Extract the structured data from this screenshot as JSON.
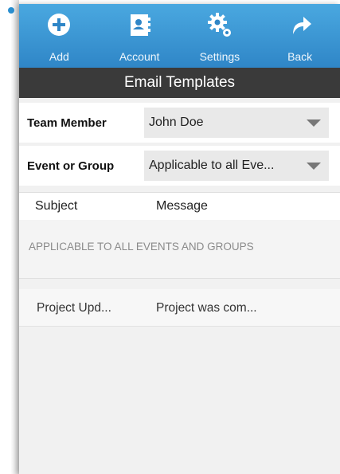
{
  "toolbar": {
    "add": {
      "label": "Add",
      "icon": "plus-circle-icon"
    },
    "account": {
      "label": "Account",
      "icon": "address-book-icon"
    },
    "settings": {
      "label": "Settings",
      "icon": "gear-icon"
    },
    "back": {
      "label": "Back",
      "icon": "back-arrow-icon"
    }
  },
  "title": "Email Templates",
  "form": {
    "team_member": {
      "label": "Team Member",
      "value": "John Doe"
    },
    "event_group": {
      "label": "Event or Group",
      "value": "Applicable to all Eve..."
    }
  },
  "table": {
    "columns": [
      "Subject",
      "Message"
    ],
    "section_header": "APPLICABLE TO ALL EVENTS AND GROUPS",
    "rows": [
      {
        "subject": "Project Upd...",
        "message": "Project was com..."
      }
    ]
  },
  "colors": {
    "toolbar": "#3b97d6",
    "titlebar": "#3a3a3a",
    "accent": "#2a8fd0"
  }
}
